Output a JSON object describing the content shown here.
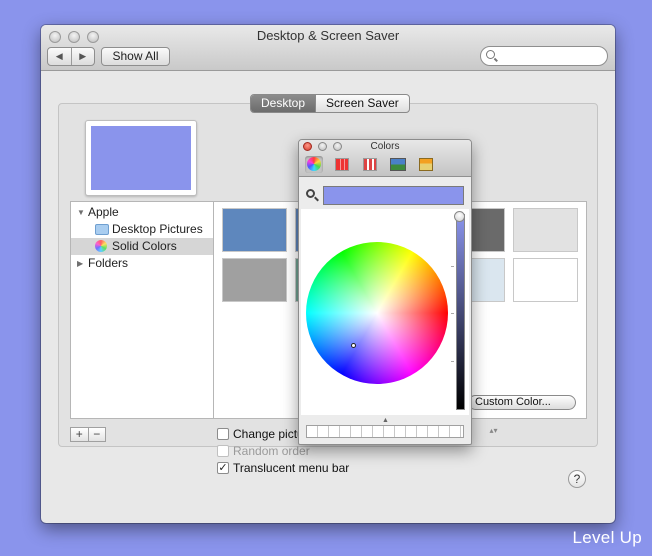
{
  "window": {
    "title": "Desktop & Screen Saver",
    "show_all_label": "Show All",
    "back_glyph": "◀",
    "forward_glyph": "▶",
    "search_placeholder": ""
  },
  "tabs": [
    {
      "label": "Desktop",
      "selected": true
    },
    {
      "label": "Screen Saver",
      "selected": false
    }
  ],
  "preview": {
    "color": "#8a94ec"
  },
  "sidebar": {
    "apple_label": "Apple",
    "desktop_pictures_label": "Desktop Pictures",
    "solid_colors_label": "Solid Colors",
    "folders_label": "Folders",
    "expanded_glyph": "▼",
    "collapsed_glyph": "▶"
  },
  "swatches": {
    "row1": [
      "#5e87bd",
      "#5d83b6",
      "#6a6a6a",
      "#e2e2e2"
    ],
    "row2": [
      "#a0a0a0",
      "#6fa090",
      "#dae6ef",
      "#ffffff"
    ]
  },
  "buttons": {
    "add": "+",
    "remove": "−",
    "custom_color": "Custom Color...",
    "help": "?"
  },
  "options": {
    "change_picture": "Change pictu",
    "random_order": "Random order",
    "translucent": "Translucent menu bar",
    "change_checked": false,
    "random_checked": false,
    "translucent_checked": true,
    "check_glyph": "✓",
    "popup_glyph": "▴▾"
  },
  "colors_panel": {
    "title": "Colors",
    "current_color": "#8a94ec",
    "tools": [
      "color-wheel-icon",
      "color-sliders-icon",
      "color-palettes-icon",
      "image-palettes-icon",
      "crayons-icon"
    ],
    "grab_glyph": "▲"
  },
  "watermark": "Level Up"
}
